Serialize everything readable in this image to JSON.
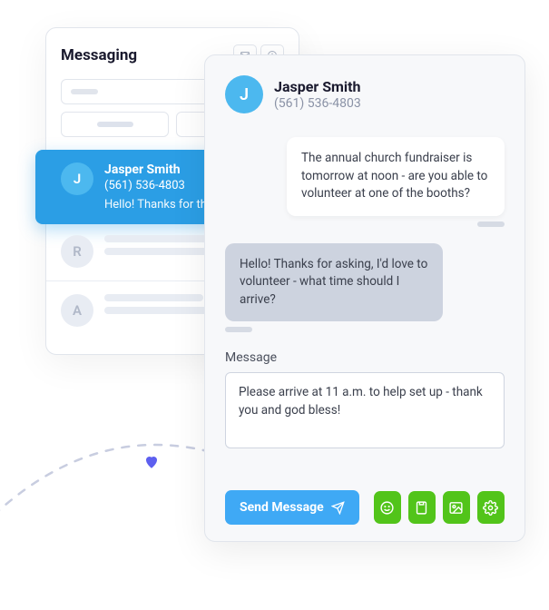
{
  "messaging": {
    "title": "Messaging",
    "conversations": [
      {
        "avatarInitial": "J",
        "name": "Jasper Smith",
        "phone": "(561) 536-4803",
        "preview": "Hello! Thanks for the ..."
      },
      {
        "avatarInitial": "R"
      },
      {
        "avatarInitial": "A"
      }
    ]
  },
  "chat": {
    "contact": {
      "avatarInitial": "J",
      "name": "Jasper Smith",
      "phone": "(561) 536-4803"
    },
    "messages": [
      {
        "direction": "incoming",
        "text": "The annual church fundraiser is tomorrow at noon - are you able to volunteer at one of the booths?"
      },
      {
        "direction": "outgoing",
        "text": "Hello! Thanks for asking, I'd love to volunteer - what time should I arrive?"
      }
    ],
    "composeLabel": "Message",
    "composeText": "Please arrive at 11 a.m. to help set up - thank you and god bless!",
    "sendLabel": "Send Message"
  }
}
